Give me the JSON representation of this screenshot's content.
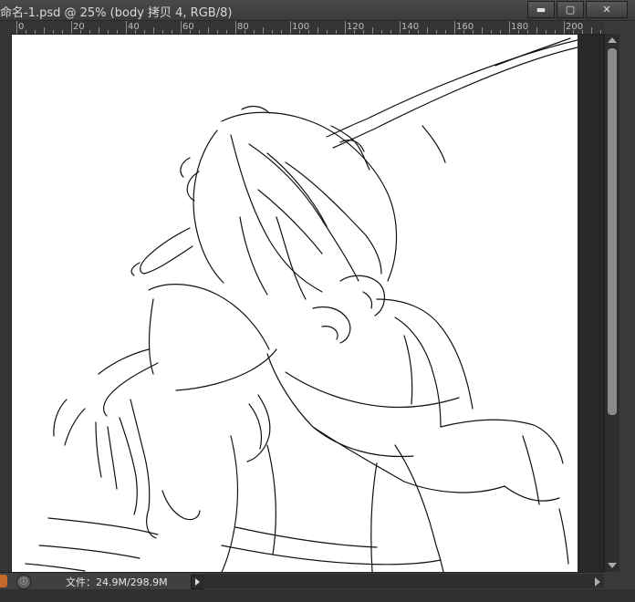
{
  "window": {
    "title": "命名-1.psd @ 25% (body 拷贝 4, RGB/8)",
    "buttons": {
      "minimize": "▬",
      "maximize": "▢",
      "close": "✕"
    }
  },
  "ruler": {
    "labels": [
      "0",
      "20",
      "40",
      "60",
      "80",
      "100",
      "120",
      "140",
      "160",
      "180",
      "200"
    ]
  },
  "status": {
    "file_info": "文件：24.9M/298.9M"
  },
  "colors": {
    "chrome": "#3a3a3a",
    "canvas": "#ffffff",
    "zoom_indicator": "#c66a2b"
  }
}
